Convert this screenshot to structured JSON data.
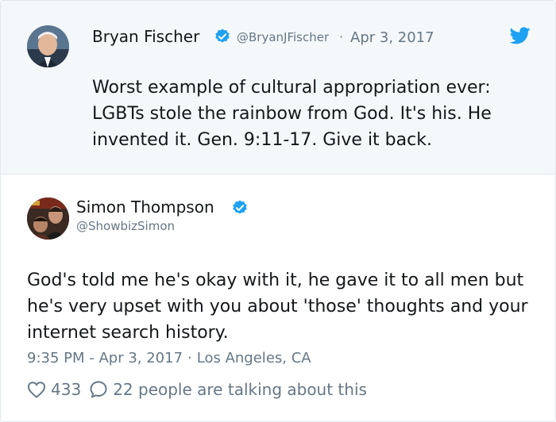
{
  "parent_tweet": {
    "author_name": "Bryan Fischer",
    "author_handle": "@BryanJFischer",
    "separator": "·",
    "date": "Apr 3, 2017",
    "text": "Worst example of cultural appropriation ever: LGBTs stole the rainbow from God. It's his. He invented it. Gen. 9:11-17. Give it back.",
    "verified": true
  },
  "reply_tweet": {
    "author_name": "Simon Thompson",
    "author_handle": "@ShowbizSimon",
    "verified": true,
    "text": "God's told me he's okay with it, he gave it to all men but he's very upset with you about 'those' thoughts and your internet search history.",
    "timestamp": "9:35 PM - Apr 3, 2017",
    "separator": "·",
    "location": "Los Angeles, CA",
    "like_count": "433",
    "conversation_text": "22 people are talking about this"
  },
  "colors": {
    "brand_blue": "#1da1f2",
    "muted_text": "#657786",
    "primary_text": "#14171a",
    "quote_background": "#f5f8fa"
  },
  "icons": {
    "verified": "verified-badge-icon",
    "bird": "twitter-bird-icon",
    "like": "heart-icon",
    "reply": "speech-bubble-icon"
  }
}
